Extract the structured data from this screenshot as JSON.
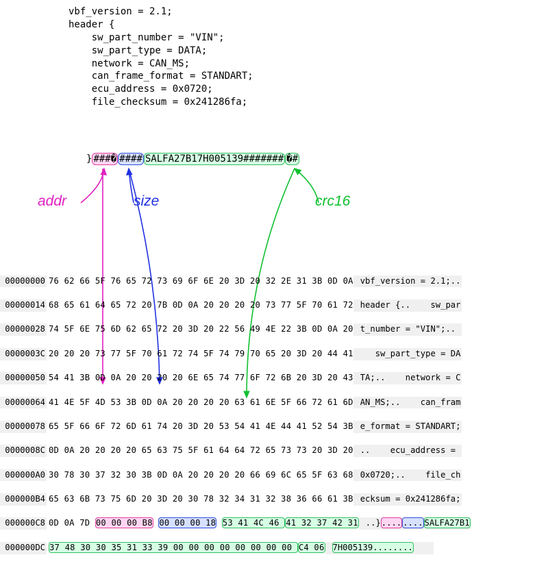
{
  "code": {
    "l1": "vbf_version = 2.1;",
    "l2": "header {",
    "l3": "    sw_part_number = \"VIN\";",
    "l4": "    sw_part_type = DATA;",
    "l5": "    network = CAN_MS;",
    "l6": "    can_frame_format = STANDART;",
    "l7": "    ecu_address = 0x0720;",
    "l8": "    file_checksum = 0x241286fa;"
  },
  "struct": {
    "before": "}",
    "addr": "###�",
    "size": "####",
    "payload": "SALFA27B17H005139#######",
    "crc": "�#"
  },
  "labels": {
    "addr": "addr",
    "size": "size",
    "crc": "crc16"
  },
  "colors": {
    "addr": "#e020c0",
    "size": "#2030e0",
    "crc": "#10c030"
  },
  "hex": [
    {
      "off": "00000000",
      "b": "76 62 66 5F 76 65 72 73 69 6F 6E 20 3D 20 32 2E 31 3B 0D 0A",
      "a": "vbf_version = 2.1;.."
    },
    {
      "off": "00000014",
      "b": "68 65 61 64 65 72 20 7B 0D 0A 20 20 20 20 73 77 5F 70 61 72",
      "a": "header {..    sw_par"
    },
    {
      "off": "00000028",
      "b": "74 5F 6E 75 6D 62 65 72 20 3D 20 22 56 49 4E 22 3B 0D 0A 20",
      "a": "t_number = \"VIN\";.. "
    },
    {
      "off": "0000003C",
      "b": "20 20 20 73 77 5F 70 61 72 74 5F 74 79 70 65 20 3D 20 44 41",
      "a": "   sw_part_type = DA"
    },
    {
      "off": "00000050",
      "b": "54 41 3B 0D 0A 20 20 20 20 6E 65 74 77 6F 72 6B 20 3D 20 43",
      "a": "TA;..    network = C"
    },
    {
      "off": "00000064",
      "b": "41 4E 5F 4D 53 3B 0D 0A 20 20 20 20 63 61 6E 5F 66 72 61 6D",
      "a": "AN_MS;..    can_fram"
    },
    {
      "off": "00000078",
      "b": "65 5F 66 6F 72 6D 61 74 20 3D 20 53 54 41 4E 44 41 52 54 3B",
      "a": "e_format = STANDART;"
    },
    {
      "off": "0000008C",
      "b": "0D 0A 20 20 20 20 65 63 75 5F 61 64 64 72 65 73 73 20 3D 20",
      "a": "..    ecu_address = "
    },
    {
      "off": "000000A0",
      "b": "30 78 30 37 32 30 3B 0D 0A 20 20 20 20 66 69 6C 65 5F 63 68",
      "a": "0x0720;..    file_ch"
    },
    {
      "off": "000000B4",
      "b": "65 63 6B 73 75 6D 20 3D 20 30 78 32 34 31 32 38 36 66 61 3B",
      "a": "ecksum = 0x241286fa;"
    }
  ],
  "hex_hl1": {
    "off": "000000C8",
    "pre": "0D 0A 7D ",
    "addr": "00 00 00 B8",
    "mid1": " ",
    "size": "00 00 00 18",
    "mid2": " ",
    "pay": "53 41 4C 46 ",
    "crc": "41 32 37 42 31",
    "a_pre": "..}",
    "a_addr": "....",
    "a_size": "....",
    "a_tail": "SALFA27B1"
  },
  "hex_hl2": {
    "off": "000000DC",
    "pay": "37 48 30 30 35 31 33 39 00 00 00 00 00 00 00 00 ",
    "crc": "C4 06",
    "a": "7H005139........"
  }
}
